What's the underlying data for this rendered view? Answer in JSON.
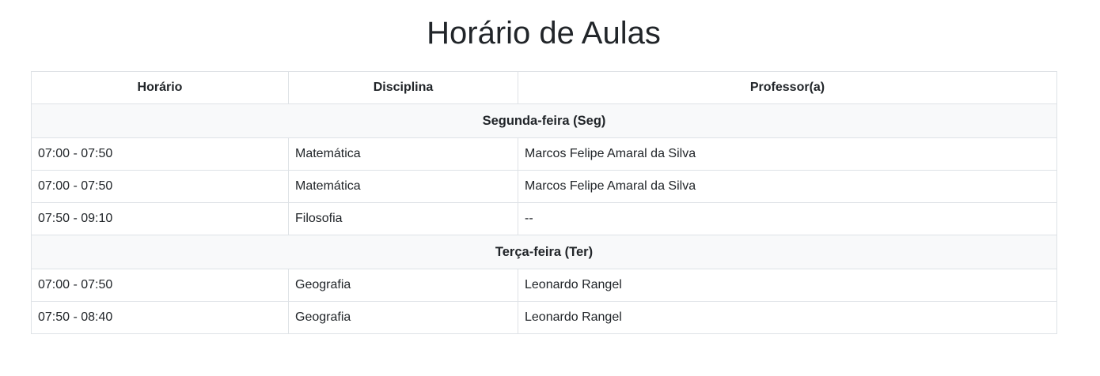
{
  "title": "Horário de Aulas",
  "table": {
    "headers": [
      "Horário",
      "Disciplina",
      "Professor(a)"
    ],
    "days": [
      {
        "label": "Segunda-feira (Seg)",
        "rows": [
          {
            "time": "07:00 - 07:50",
            "subject": "Matemática",
            "teacher": "Marcos Felipe Amaral da Silva"
          },
          {
            "time": "07:00 - 07:50",
            "subject": "Matemática",
            "teacher": "Marcos Felipe Amaral da Silva"
          },
          {
            "time": "07:50 - 09:10",
            "subject": "Filosofia",
            "teacher": "--"
          }
        ]
      },
      {
        "label": "Terça-feira (Ter)",
        "rows": [
          {
            "time": "07:00 - 07:50",
            "subject": "Geografia",
            "teacher": "Leonardo Rangel"
          },
          {
            "time": "07:50 - 08:40",
            "subject": "Geografia",
            "teacher": "Leonardo Rangel"
          }
        ]
      }
    ]
  }
}
